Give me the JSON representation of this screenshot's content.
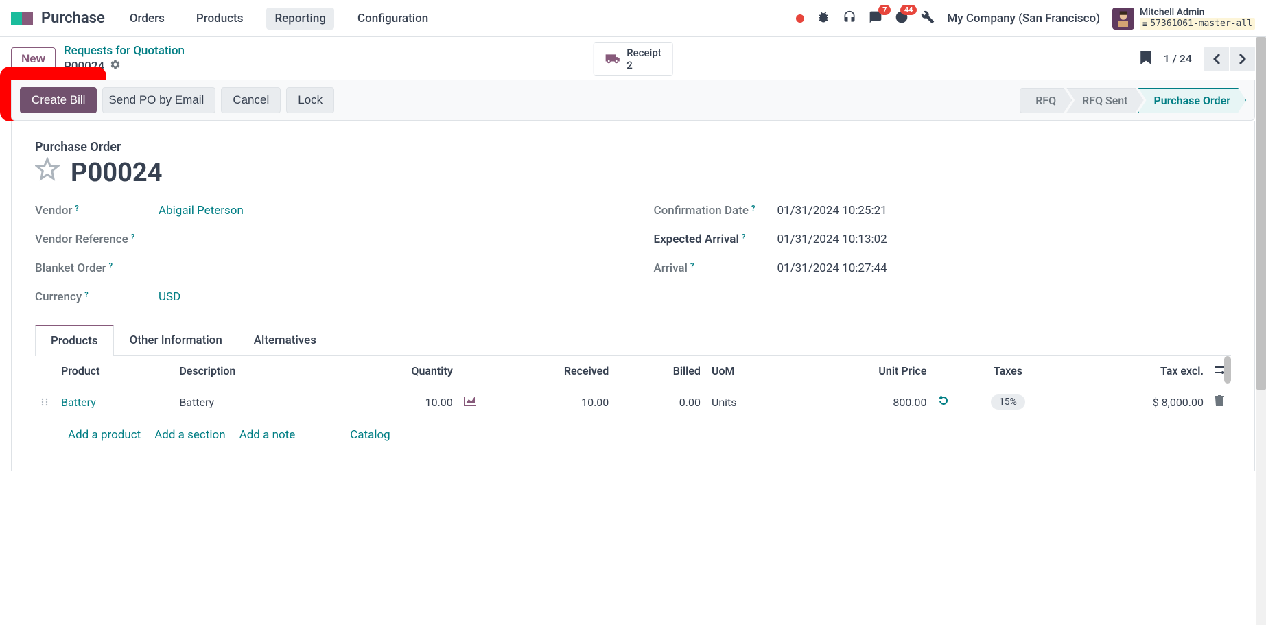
{
  "topnav": {
    "app_name": "Purchase",
    "menu": [
      "Orders",
      "Products",
      "Reporting",
      "Configuration"
    ],
    "active_menu_index": 2,
    "chat_badge": "7",
    "activity_badge": "44",
    "company": "My Company (San Francisco)",
    "user_name": "Mitchell Admin",
    "db_name": "57361061-master-all"
  },
  "control": {
    "new_label": "New",
    "breadcrumb_link": "Requests for Quotation",
    "breadcrumb_current": "P00024",
    "receipt_label": "Receipt",
    "receipt_count": "2",
    "pager": "1 / 24"
  },
  "statusbar": {
    "buttons": {
      "create_bill": "Create Bill",
      "send_po": "Send PO by Email",
      "cancel": "Cancel",
      "lock": "Lock"
    },
    "stages": [
      "RFQ",
      "RFQ Sent",
      "Purchase Order"
    ],
    "active_stage_index": 2
  },
  "form": {
    "title_label": "Purchase Order",
    "order_name": "P00024",
    "left": {
      "vendor_label": "Vendor",
      "vendor_value": "Abigail Peterson",
      "vendor_ref_label": "Vendor Reference",
      "blanket_label": "Blanket Order",
      "currency_label": "Currency",
      "currency_value": "USD"
    },
    "right": {
      "confirm_label": "Confirmation Date",
      "confirm_value": "01/31/2024 10:25:21",
      "expected_label": "Expected Arrival",
      "expected_value": "01/31/2024 10:13:02",
      "arrival_label": "Arrival",
      "arrival_value": "01/31/2024 10:27:44"
    }
  },
  "tabs": [
    "Products",
    "Other Information",
    "Alternatives"
  ],
  "active_tab_index": 0,
  "table": {
    "headers": {
      "product": "Product",
      "description": "Description",
      "quantity": "Quantity",
      "received": "Received",
      "billed": "Billed",
      "uom": "UoM",
      "unit_price": "Unit Price",
      "taxes": "Taxes",
      "tax_excl": "Tax excl."
    },
    "row": {
      "product": "Battery",
      "description": "Battery",
      "quantity": "10.00",
      "received": "10.00",
      "billed": "0.00",
      "uom": "Units",
      "unit_price": "800.00",
      "taxes": "15%",
      "tax_excl": "$ 8,000.00"
    },
    "footer_links": {
      "add_product": "Add a product",
      "add_section": "Add a section",
      "add_note": "Add a note",
      "catalog": "Catalog"
    }
  }
}
